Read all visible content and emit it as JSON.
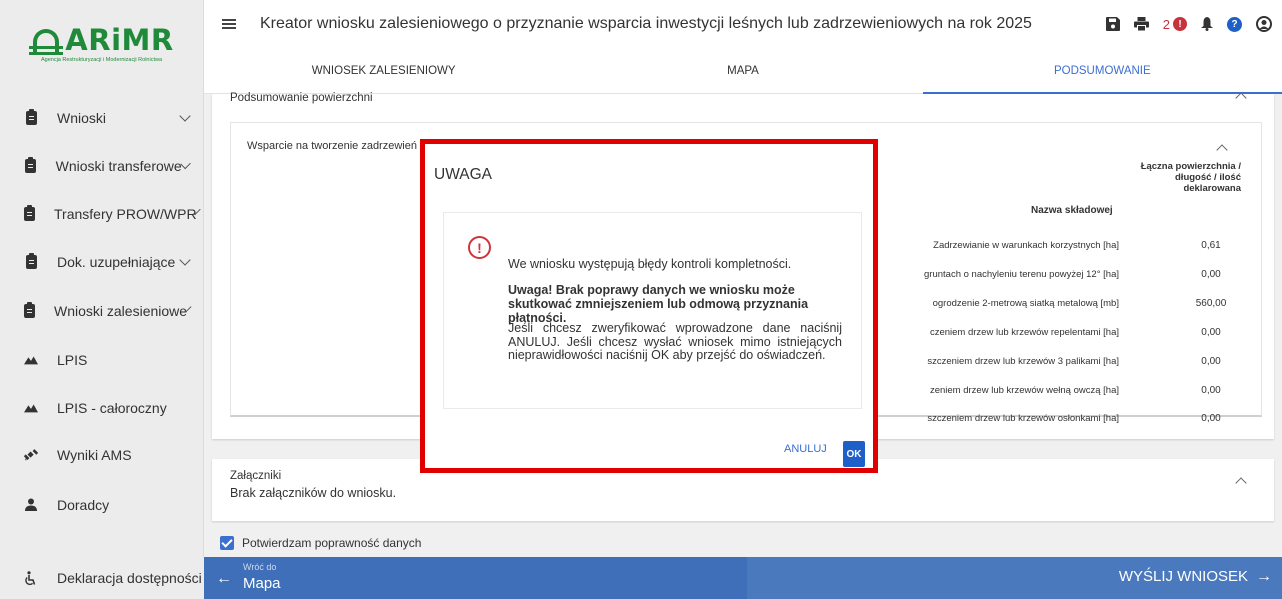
{
  "logo": {
    "brand": "ARiMR",
    "subtitle": "Agencja Restrukturyzacji i Modernizacji Rolnictwa"
  },
  "sidebar": {
    "items": [
      {
        "label": "Wnioski",
        "icon": "clipboard-icon",
        "expandable": true
      },
      {
        "label": "Wnioski transferowe",
        "icon": "clipboard-icon",
        "expandable": true
      },
      {
        "label": "Transfery PROW/WPR",
        "icon": "clipboard-icon",
        "expandable": true
      },
      {
        "label": "Dok. uzupełniające",
        "icon": "clipboard-icon",
        "expandable": true
      },
      {
        "label": "Wnioski zalesieniowe",
        "icon": "clipboard-icon",
        "expandable": true
      },
      {
        "label": "LPIS",
        "icon": "terrain-icon",
        "expandable": false
      },
      {
        "label": "LPIS - całoroczny",
        "icon": "terrain-icon",
        "expandable": false
      },
      {
        "label": "Wyniki AMS",
        "icon": "satellite-icon",
        "expandable": false
      },
      {
        "label": "Doradcy",
        "icon": "person-icon",
        "expandable": false
      }
    ],
    "accessibility": "Deklaracja dostępności"
  },
  "header": {
    "title": "Kreator wniosku zalesieniowego o przyznanie wsparcia inwestycji leśnych lub zadrzewieniowych na rok 2025",
    "error_count": "2"
  },
  "tabs": [
    {
      "label": "WNIOSEK ZALESIENIOWY",
      "active": false
    },
    {
      "label": "MAPA",
      "active": false
    },
    {
      "label": "PODSUMOWANIE",
      "active": true
    }
  ],
  "summary": {
    "title": "Podsumowanie powierzchni",
    "inner_title": "Wsparcie na tworzenie zadrzewień",
    "col_name": "Nazwa składowej",
    "col_total": "Łączna powierzchnia / długość / ilość deklarowana",
    "rows": [
      {
        "name": "Zadrzewianie w warunkach korzystnych [ha]",
        "value": "0,61"
      },
      {
        "name": "gruntach o nachyleniu terenu powyżej 12° [ha]",
        "value": "0,00"
      },
      {
        "name": "ogrodzenie 2-metrową siatką metalową [mb]",
        "value": "560,00"
      },
      {
        "name": "czeniem drzew lub krzewów repelentami [ha]",
        "value": "0,00"
      },
      {
        "name": "szczeniem drzew lub krzewów 3 palikami [ha]",
        "value": "0,00"
      },
      {
        "name": "zeniem drzew lub krzewów wełną owczą [ha]",
        "value": "0,00"
      },
      {
        "name": "szczeniem drzew lub krzewów osłonkami [ha]",
        "value": "0,00"
      }
    ]
  },
  "attachments": {
    "title": "Załączniki",
    "text": "Brak załączników do wniosku."
  },
  "confirm": {
    "label": "Potwierdzam poprawność danych",
    "checked": true
  },
  "bottom": {
    "back_small": "Wróć do",
    "back_main": "Mapa",
    "send": "WYŚLIJ WNIOSEK"
  },
  "modal": {
    "title": "UWAGA",
    "line1": "We wniosku występują błędy kontroli kompletności.",
    "line2": "Uwaga! Brak poprawy danych we wniosku może skutkować zmniejszeniem lub odmową przyznania płatności.",
    "line3": "Jeśli chcesz zweryfikować wprowadzone dane naciśnij ANULUJ. Jeśli chcesz wysłać wniosek mimo istniejących nieprawidłowości naciśnij OK aby przejść do oświadczeń.",
    "cancel": "ANULUJ",
    "ok": "OK"
  },
  "colors": {
    "accent": "#3b6fd0",
    "brand": "#1f8a3a",
    "highlight": "#e00000",
    "error": "#c8323c"
  }
}
